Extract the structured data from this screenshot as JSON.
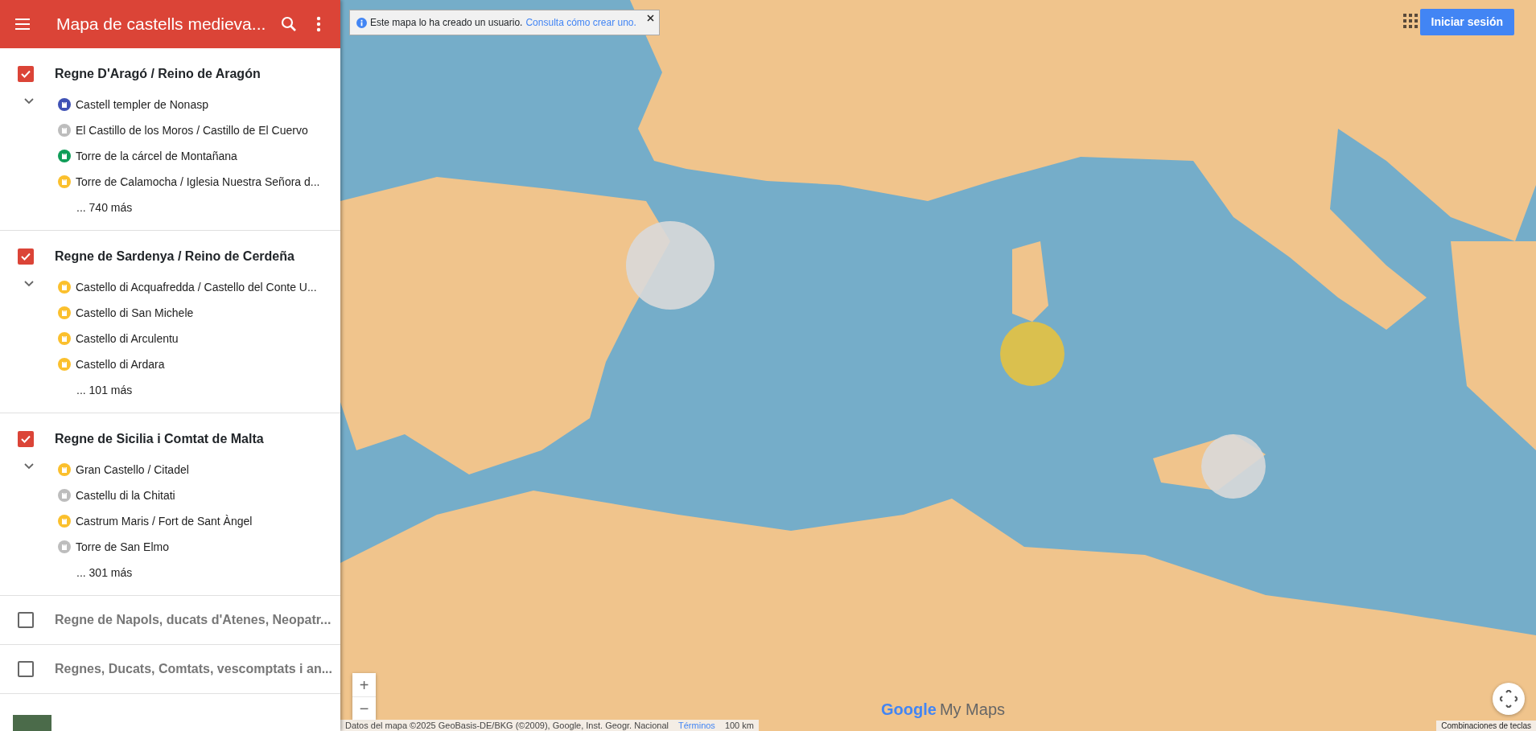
{
  "header": {
    "title": "Mapa de castells medieva..."
  },
  "layers": [
    {
      "title": "Regne D'Aragó / Reino de Aragón",
      "checked": true,
      "expanded": true,
      "items": [
        {
          "name": "Castell templer de Nonasp",
          "color": "#3f51b5"
        },
        {
          "name": "El Castillo de los Moros / Castillo de El Cuervo",
          "color": "#bdbdbd"
        },
        {
          "name": "Torre de la cárcel de Montañana",
          "color": "#0f9d58"
        },
        {
          "name": "Torre de Calamocha / Iglesia Nuestra Señora d...",
          "color": "#fbc02d"
        }
      ],
      "more": "... 740 más"
    },
    {
      "title": "Regne de Sardenya / Reino de Cerdeña",
      "checked": true,
      "expanded": true,
      "items": [
        {
          "name": "Castello di Acquafredda / Castello del Conte U...",
          "color": "#fbc02d"
        },
        {
          "name": "Castello di San Michele",
          "color": "#fbc02d"
        },
        {
          "name": "Castello di Arculentu",
          "color": "#fbc02d"
        },
        {
          "name": "Castello di Ardara",
          "color": "#fbc02d"
        }
      ],
      "more": "... 101 más"
    },
    {
      "title": "Regne de Sicilia i Comtat de Malta",
      "checked": true,
      "expanded": true,
      "items": [
        {
          "name": "Gran Castello / Citadel",
          "color": "#fbc02d"
        },
        {
          "name": "Castellu di la Chitati",
          "color": "#bdbdbd"
        },
        {
          "name": "Castrum Maris / Fort de Sant Àngel",
          "color": "#fbc02d"
        },
        {
          "name": "Torre de San Elmo",
          "color": "#bdbdbd"
        }
      ],
      "more": "... 301 más"
    },
    {
      "title": "Regne de Napols, ducats d'Atenes, Neopatr...",
      "checked": false,
      "expanded": false
    },
    {
      "title": "Regnes, Ducats, Comtats, vescomptats i an...",
      "checked": false,
      "expanded": false
    }
  ],
  "banner": {
    "text": "Este mapa lo ha creado un usuario.",
    "link": "Consulta cómo crear uno."
  },
  "signin": "Iniciar sesión",
  "zoom": {
    "in": "+",
    "out": "−"
  },
  "logo": {
    "google": "Google",
    "product": "My Maps"
  },
  "footer": {
    "attribution": "Datos del mapa ©2025 GeoBasis-DE/BKG (©2009), Google, Inst. Geogr. Nacional",
    "terms": "Términos",
    "scale": "100 km",
    "shortcuts": "Combinaciones de teclas"
  }
}
